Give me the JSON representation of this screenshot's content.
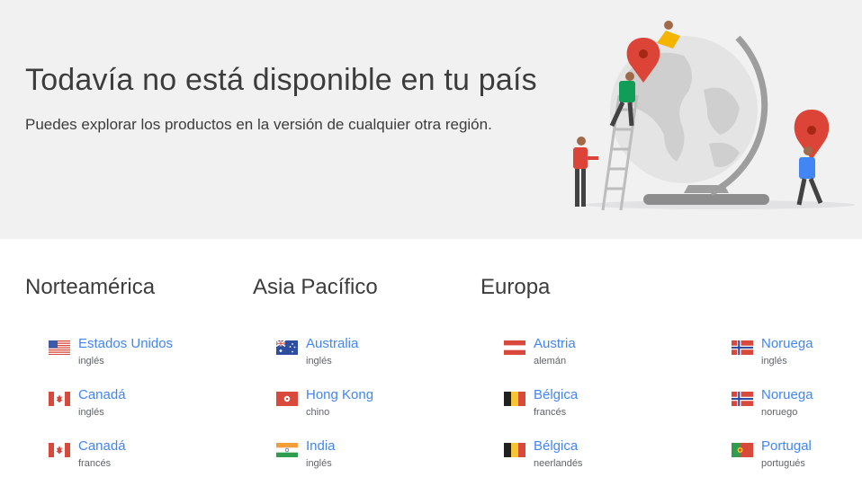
{
  "hero": {
    "title": "Todavía no está disponible en tu país",
    "subtitle": "Puedes explorar los productos en la versión de cualquier otra región."
  },
  "colors": {
    "link": "#4285f4",
    "hero_bg": "#f1f1f2",
    "text": "#3c3c3c",
    "muted": "#5f6368",
    "pin": "#db4437"
  },
  "regions": [
    {
      "heading": "Norteamérica",
      "countries": [
        {
          "name": "Estados Unidos",
          "language": "inglés",
          "flag": "us-flag-icon"
        },
        {
          "name": "Canadá",
          "language": "inglés",
          "flag": "canada-flag-icon"
        },
        {
          "name": "Canadá",
          "language": "francés",
          "flag": "canada-flag-icon"
        }
      ]
    },
    {
      "heading": "Asia Pacífico",
      "countries": [
        {
          "name": "Australia",
          "language": "inglés",
          "flag": "australia-flag-icon"
        },
        {
          "name": "Hong Kong",
          "language": "chino",
          "flag": "hong-kong-flag-icon"
        },
        {
          "name": "India",
          "language": "inglés",
          "flag": "india-flag-icon"
        }
      ]
    },
    {
      "heading": "Europa",
      "countries": [
        {
          "name": "Austria",
          "language": "alemán",
          "flag": "austria-flag-icon"
        },
        {
          "name": "Bélgica",
          "language": "francés",
          "flag": "belgium-flag-icon"
        },
        {
          "name": "Bélgica",
          "language": "neerlandés",
          "flag": "belgium-flag-icon"
        },
        {
          "name": "Noruega",
          "language": "inglés",
          "flag": "norway-flag-icon"
        },
        {
          "name": "Noruega",
          "language": "noruego",
          "flag": "norway-flag-icon"
        },
        {
          "name": "Portugal",
          "language": "portugués",
          "flag": "portugal-flag-icon"
        }
      ]
    }
  ]
}
